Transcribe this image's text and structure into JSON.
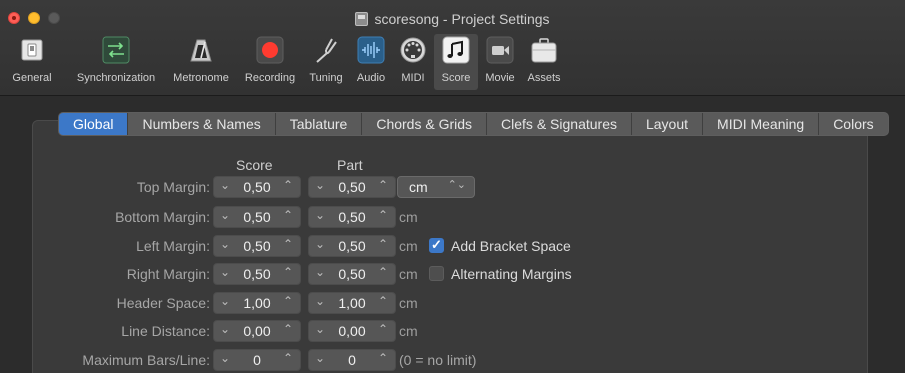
{
  "window": {
    "title": "scoresong - Project Settings"
  },
  "toolbar": [
    {
      "label": "General",
      "icon": "switch-icon"
    },
    {
      "label": "Synchronization",
      "icon": "sync-arrows-icon"
    },
    {
      "label": "Metronome",
      "icon": "metronome-icon"
    },
    {
      "label": "Recording",
      "icon": "record-icon"
    },
    {
      "label": "Tuning",
      "icon": "tuning-fork-icon"
    },
    {
      "label": "Audio",
      "icon": "audio-waveform-icon"
    },
    {
      "label": "MIDI",
      "icon": "midi-port-icon"
    },
    {
      "label": "Score",
      "icon": "music-note-icon"
    },
    {
      "label": "Movie",
      "icon": "movie-camera-icon"
    },
    {
      "label": "Assets",
      "icon": "briefcase-icon"
    }
  ],
  "selected_toolbar": "Score",
  "tabs": [
    "Global",
    "Numbers & Names",
    "Tablature",
    "Chords & Grids",
    "Clefs & Signatures",
    "Layout",
    "MIDI Meaning",
    "Colors"
  ],
  "active_tab": "Global",
  "columns": {
    "score": "Score",
    "part": "Part"
  },
  "unit_select": {
    "value": "cm"
  },
  "rows": [
    {
      "label": "Top Margin:",
      "score": "0,50",
      "part": "0,50",
      "unit": ""
    },
    {
      "label": "Bottom Margin:",
      "score": "0,50",
      "part": "0,50",
      "unit": "cm"
    },
    {
      "label": "Left Margin:",
      "score": "0,50",
      "part": "0,50",
      "unit": "cm"
    },
    {
      "label": "Right Margin:",
      "score": "0,50",
      "part": "0,50",
      "unit": "cm"
    },
    {
      "label": "Header Space:",
      "score": "1,00",
      "part": "1,00",
      "unit": "cm"
    },
    {
      "label": "Line Distance:",
      "score": "0,00",
      "part": "0,00",
      "unit": "cm"
    },
    {
      "label": "Maximum Bars/Line:",
      "score": "0",
      "part": "0",
      "unit": "(0 = no limit)"
    }
  ],
  "checkboxes": {
    "add_bracket_space": {
      "label": "Add Bracket Space",
      "checked": true
    },
    "alternating_margins": {
      "label": "Alternating Margins",
      "checked": false
    }
  },
  "colors": {
    "accent": "#3c78c8",
    "record": "#ff3b30"
  }
}
